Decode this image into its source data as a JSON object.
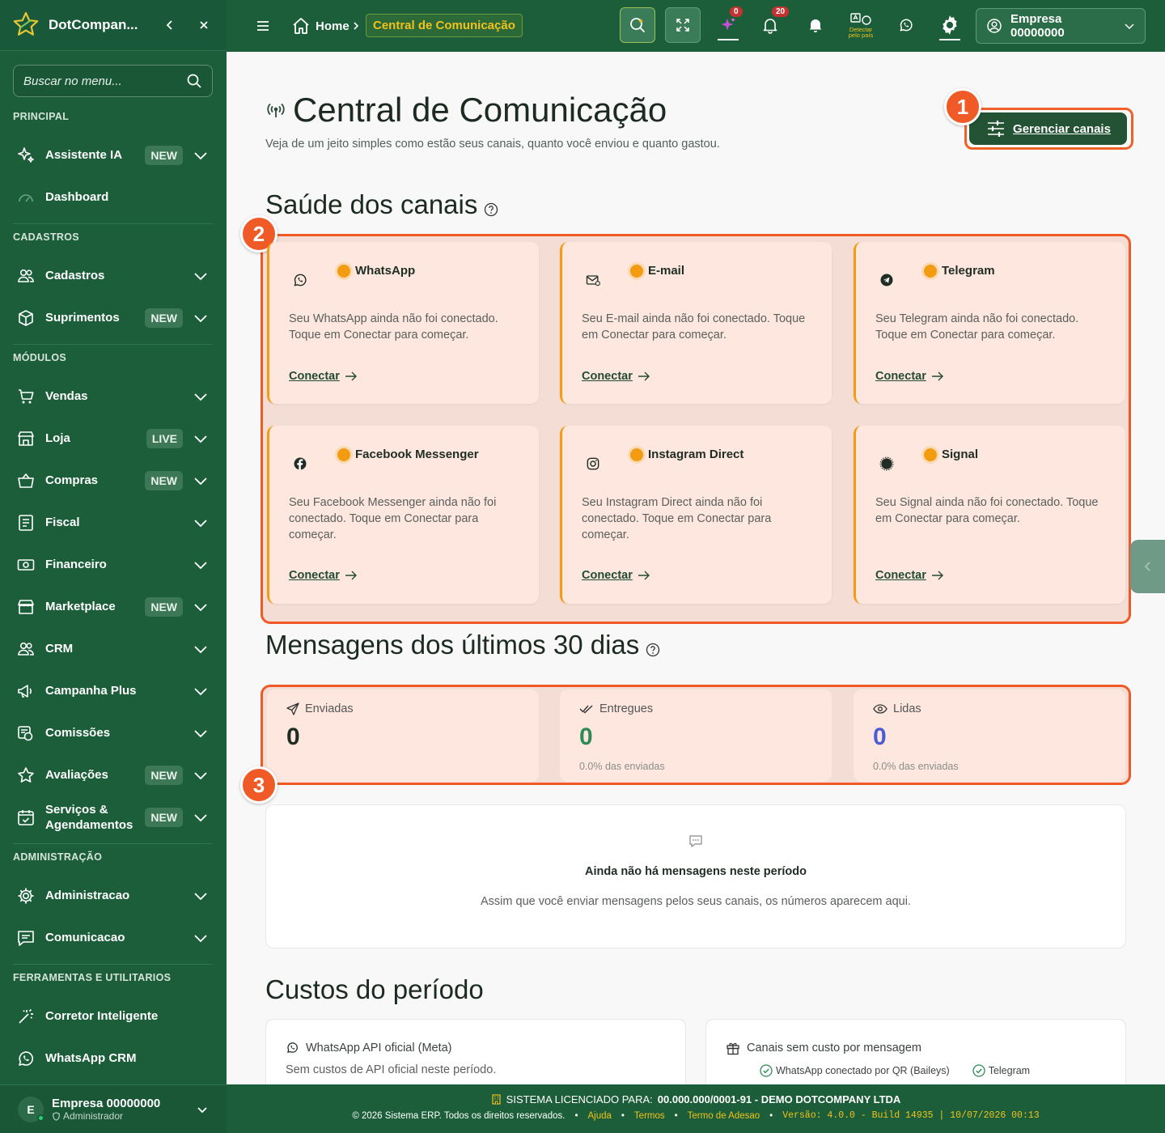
{
  "sidebar": {
    "brand": "DotCompan...",
    "search_placeholder": "Buscar no menu...",
    "sections": {
      "principal": "PRINCIPAL",
      "cadastros": "CADASTROS",
      "modulos": "MÓDULOS",
      "administracao": "ADMINISTRAÇÃO",
      "ferramentas": "FERRAMENTAS E UTILITARIOS"
    },
    "items": {
      "assistente": {
        "label": "Assistente IA",
        "badge": "NEW"
      },
      "dashboard": {
        "label": "Dashboard"
      },
      "cadastros": {
        "label": "Cadastros"
      },
      "suprimentos": {
        "label": "Suprimentos",
        "badge": "NEW"
      },
      "vendas": {
        "label": "Vendas"
      },
      "loja": {
        "label": "Loja",
        "badge": "LIVE"
      },
      "compras": {
        "label": "Compras",
        "badge": "NEW"
      },
      "fiscal": {
        "label": "Fiscal"
      },
      "financeiro": {
        "label": "Financeiro"
      },
      "marketplace": {
        "label": "Marketplace",
        "badge": "NEW"
      },
      "crm": {
        "label": "CRM"
      },
      "campanha": {
        "label": "Campanha Plus"
      },
      "comissoes": {
        "label": "Comissões"
      },
      "avaliacoes": {
        "label": "Avaliações",
        "badge": "NEW"
      },
      "servicos": {
        "label": "Serviços & Agendamentos",
        "badge": "NEW"
      },
      "administracao": {
        "label": "Administracao"
      },
      "comunicacao": {
        "label": "Comunicacao"
      },
      "corretor": {
        "label": "Corretor Inteligente"
      },
      "whatsapp_crm": {
        "label": "WhatsApp CRM"
      }
    },
    "user": {
      "initial": "E",
      "name": "Empresa 00000000",
      "role": "Administrador"
    }
  },
  "topbar": {
    "home": "Home",
    "current": "Central de Comunicação",
    "ai_badge": "0",
    "notif_badge": "20",
    "detect_label": "Detectar pelo país",
    "company": "Empresa 00000000"
  },
  "page": {
    "title": "Central de Comunicação",
    "subtitle": "Veja de um jeito simples como estão seus canais, quanto você enviou e quanto gastou.",
    "manage_button": "Gerenciar canais",
    "markers": [
      "1",
      "2",
      "3"
    ],
    "health_title": "Saúde dos canais",
    "channels": [
      {
        "name": "WhatsApp",
        "icon": "whatsapp-icon",
        "desc": "Seu WhatsApp ainda não foi conectado. Toque em Conectar para começar.",
        "action": "Conectar"
      },
      {
        "name": "E-mail",
        "icon": "email-icon",
        "desc": "Seu E-mail ainda não foi conectado. Toque em Conectar para começar.",
        "action": "Conectar"
      },
      {
        "name": "Telegram",
        "icon": "telegram-icon",
        "desc": "Seu Telegram ainda não foi conectado. Toque em Conectar para começar.",
        "action": "Conectar"
      },
      {
        "name": "Facebook Messenger",
        "icon": "facebook-icon",
        "desc": "Seu Facebook Messenger ainda não foi conectado. Toque em Conectar para começar.",
        "action": "Conectar"
      },
      {
        "name": "Instagram Direct",
        "icon": "instagram-icon",
        "desc": "Seu Instagram Direct ainda não foi conectado. Toque em Conectar para começar.",
        "action": "Conectar"
      },
      {
        "name": "Signal",
        "icon": "signal-icon",
        "desc": "Seu Signal ainda não foi conectado. Toque em Conectar para começar.",
        "action": "Conectar"
      }
    ],
    "messages_title": "Mensagens dos últimos 30 dias",
    "stats": {
      "sent": {
        "label": "Enviadas",
        "value": "0"
      },
      "delivered": {
        "label": "Entregues",
        "value": "0",
        "sub": "0.0% das enviadas"
      },
      "read": {
        "label": "Lidas",
        "value": "0",
        "sub": "0.0% das enviadas"
      }
    },
    "empty": {
      "title": "Ainda não há mensagens neste período",
      "subtitle": "Assim que você enviar mensagens pelos seus canais, os números aparecem aqui."
    },
    "costs_title": "Custos do período",
    "cost_api": {
      "title": "WhatsApp API oficial (Meta)",
      "desc": "Sem custos de API oficial neste período."
    },
    "cost_free": {
      "title": "Canais sem custo por mensagem",
      "chips": [
        "WhatsApp conectado por QR (Baileys)",
        "Telegram"
      ]
    }
  },
  "footer": {
    "license_label": "SISTEMA LICENCIADO PARA:",
    "license_value": "00.000.000/0001-91 - DEMO DOTCOMPANY LTDA",
    "copyright": "© 2026 Sistema ERP. Todos os direitos reservados.",
    "links": [
      "Ajuda",
      "Termos",
      "Termo de Adesao"
    ],
    "version": "Versão: 4.0.0 - Build 14935 | 10/07/2026 00:13"
  },
  "colors": {
    "primary": "#1c5e3a",
    "accent": "#ef5a27",
    "warning": "#f39c12",
    "highlight": "#f1c21b",
    "delivered": "#2e8b57",
    "read": "#4a5bd4"
  }
}
